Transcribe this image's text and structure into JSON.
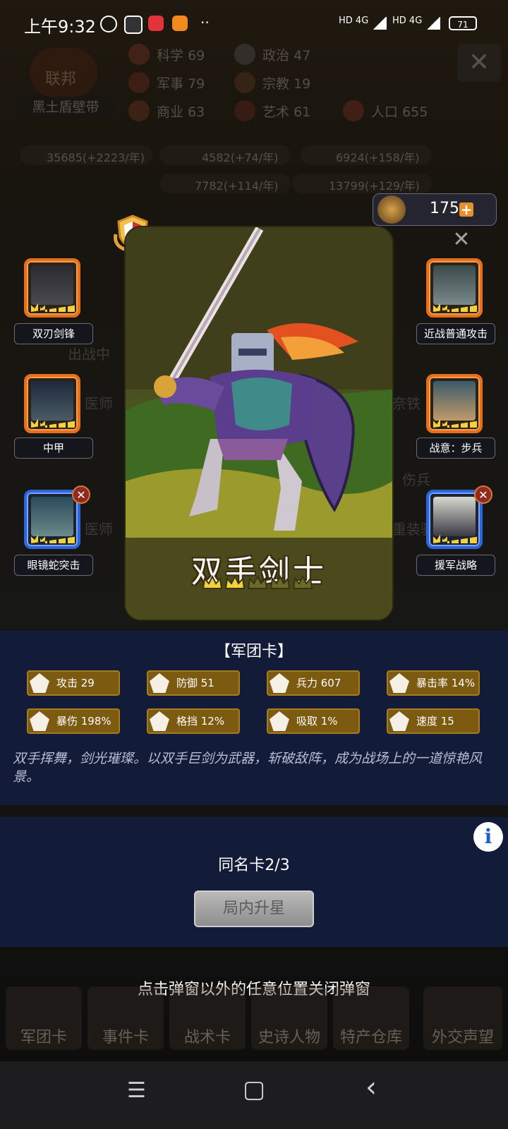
{
  "status_bar": {
    "time": "上午9:32",
    "net1": "HD 4G",
    "net2": "HD 4G",
    "battery": "71"
  },
  "hud": {
    "faction_badge": "联邦",
    "faction_name": "黑土盾壁带",
    "stats": [
      {
        "label": "科学",
        "value": "69",
        "icon": "science-icon"
      },
      {
        "label": "政治",
        "value": "47",
        "icon": "politics-icon"
      },
      {
        "label": "军事",
        "value": "79",
        "icon": "military-icon"
      },
      {
        "label": "宗教",
        "value": "19",
        "icon": "religion-icon"
      },
      {
        "label": "商业",
        "value": "63",
        "icon": "commerce-icon"
      },
      {
        "label": "艺术",
        "value": "61",
        "icon": "art-icon"
      },
      {
        "label": "人口",
        "value": "655",
        "icon": "population-icon"
      }
    ],
    "resources": [
      "35685(+2223/年)",
      "4582(+74/年)",
      "6924(+158/年)",
      "7782(+114/年)",
      "13799(+129/年)"
    ],
    "points": "175"
  },
  "background_labels": [
    "出战中",
    "医师",
    "奈铁",
    "伤兵",
    "医师",
    "重装骑"
  ],
  "card": {
    "name": "双手剑士",
    "stars_filled": 2,
    "stars_total": 5
  },
  "skills_left": [
    {
      "label": "双刃剑锋",
      "frame": "orange",
      "removable": false
    },
    {
      "label": "中甲",
      "frame": "orange",
      "removable": false
    },
    {
      "label": "眼镜蛇突击",
      "frame": "blue",
      "removable": true
    }
  ],
  "skills_right": [
    {
      "label": "近战普通攻击",
      "frame": "orange",
      "removable": false
    },
    {
      "label": "战意：步兵",
      "frame": "orange",
      "removable": false
    },
    {
      "label": "援军战略",
      "frame": "blue",
      "removable": true
    }
  ],
  "panel": {
    "title": "【军团卡】",
    "stats": [
      {
        "label": "攻击 29",
        "icon": "sword-icon"
      },
      {
        "label": "防御 51",
        "icon": "shield-icon"
      },
      {
        "label": "兵力 607",
        "icon": "heart-icon"
      },
      {
        "label": "暴击率 14%",
        "icon": "crit-rate-icon"
      },
      {
        "label": "暴伤 198%",
        "icon": "crit-damage-icon"
      },
      {
        "label": "格挡 12%",
        "icon": "block-icon"
      },
      {
        "label": "吸取 1%",
        "icon": "lifesteal-icon"
      },
      {
        "label": "速度 15",
        "icon": "speed-icon"
      }
    ],
    "description": "双手挥舞，剑光璀璨。以双手巨剑为武器，斩破敌阵，成为战场上的一道惊艳风景。"
  },
  "upgrade": {
    "duplicate_count": "同名卡2/3",
    "button_label": "局内升星",
    "info_glyph": "i"
  },
  "close_hint": "点击弹窗以外的任意位置关闭弹窗",
  "bottom_tabs": [
    "军团卡",
    "事件卡",
    "战术卡",
    "史诗人物",
    "特产仓库",
    "外交声望"
  ],
  "navbar": {
    "menu": "☰",
    "home": "▢",
    "back": "‹"
  }
}
